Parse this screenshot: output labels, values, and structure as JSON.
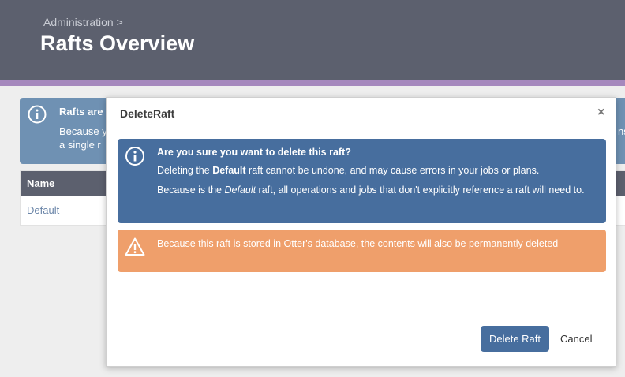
{
  "header": {
    "breadcrumb": "Administration >",
    "title": "Rafts Overview"
  },
  "background": {
    "info_title": "Rafts are",
    "info_text_line1": "Because y",
    "info_text_line1_end": "ns",
    "info_text_line2": "a single r",
    "table": {
      "columns": [
        "Name"
      ],
      "rows": [
        "Default"
      ]
    }
  },
  "modal": {
    "title": "DeleteRaft",
    "close_glyph": "×",
    "info_alert": {
      "heading": "Are you sure you want to delete this raft?",
      "line1_a": "Deleting the ",
      "line1_bold": "Default",
      "line1_b": " raft cannot be undone, and may cause errors in your jobs or plans.",
      "line2_a": "Because is the ",
      "line2_italic": "Default",
      "line2_b": " raft, all operations and jobs that don't explicitly reference a raft will need to."
    },
    "warning_alert": {
      "text": "Because this raft is stored in Otter's database, the contents will also be permanently deleted"
    },
    "buttons": {
      "delete": "Delete Raft",
      "cancel": "Cancel"
    }
  },
  "colors": {
    "header": "#5c606e",
    "stripe": "#a588bd",
    "info": "#476e9e",
    "warning": "#ef9f6b"
  }
}
